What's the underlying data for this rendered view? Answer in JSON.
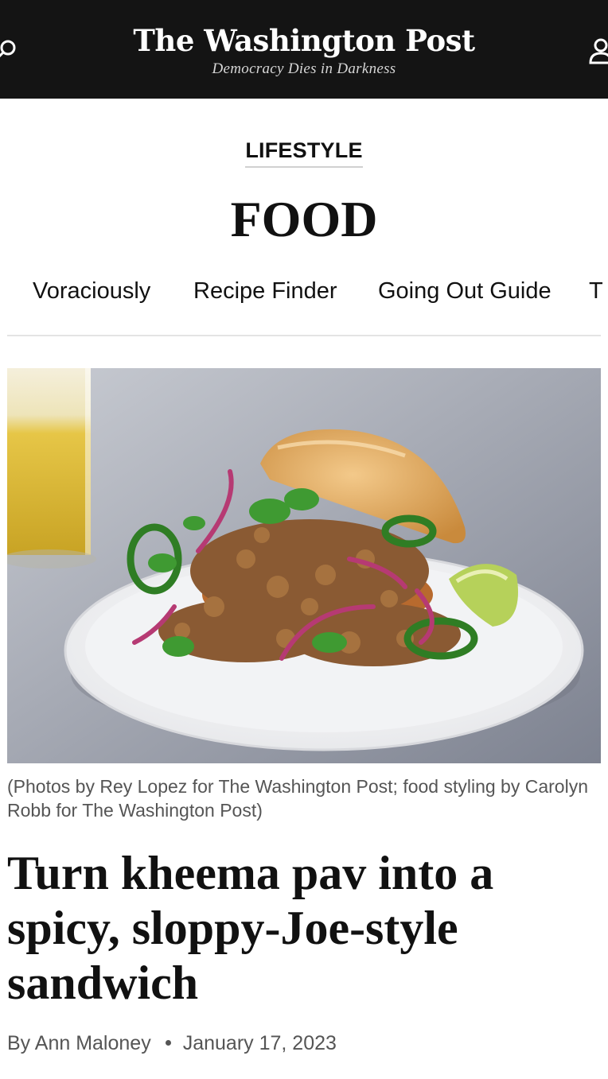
{
  "header": {
    "masthead": "The Washington Post",
    "tagline": "Democracy Dies in Darkness",
    "background": "#141414"
  },
  "section": {
    "kicker": "LIFESTYLE",
    "title": "FOOD"
  },
  "subnav": {
    "items": [
      "Voraciously",
      "Recipe Finder",
      "Going Out Guide",
      "T"
    ]
  },
  "article": {
    "caption": "(Photos by Rey Lopez for The Washington Post; food styling by Carolyn Robb for The Washington Post)",
    "headline": "Turn kheema pav into a spicy, sloppy-Joe-style sandwich",
    "byline_prefix": "By",
    "author": "Ann Maloney",
    "date": "January 17, 2023"
  },
  "icons": {
    "search": "search-icon",
    "account": "account-icon"
  }
}
